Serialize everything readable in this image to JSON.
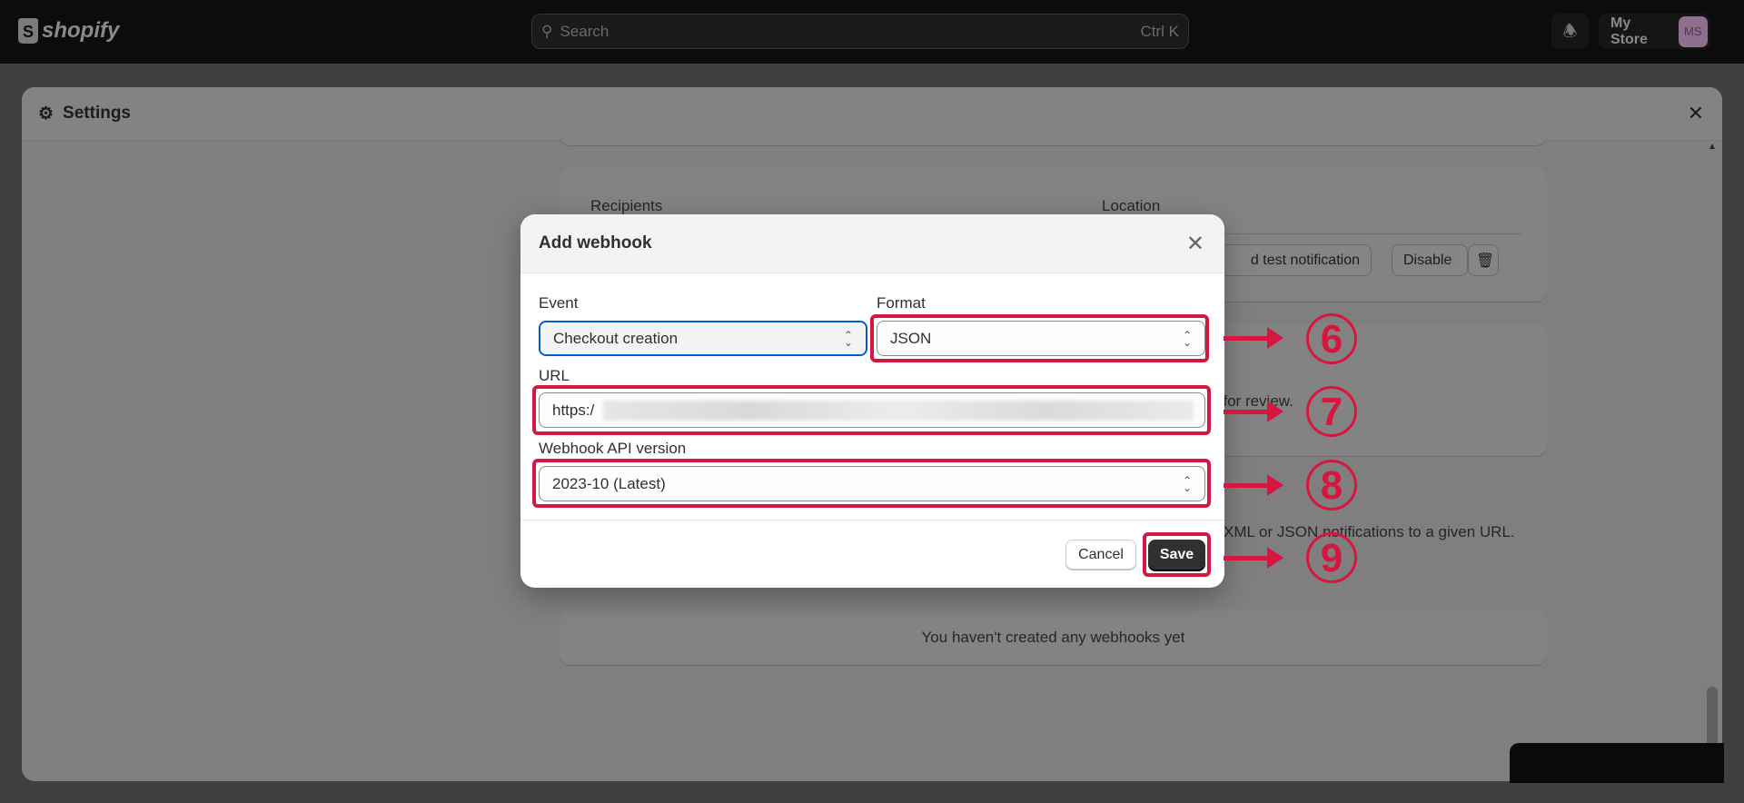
{
  "topbar": {
    "logo": "shopify",
    "search_placeholder": "Search",
    "search_shortcut": "Ctrl K",
    "store_name": "My Store",
    "avatar_initials": "MS"
  },
  "settings": {
    "title": "Settings"
  },
  "background": {
    "recipients_header": "Recipients",
    "location_header": "Location",
    "send_test_label": "d test notification",
    "disable_label": "Disable",
    "review_text": "r for review.",
    "webhooks_desc": "XML or JSON notifications to a given URL.",
    "empty_state": "You haven't created any webhooks yet"
  },
  "modal": {
    "title": "Add webhook",
    "event_label": "Event",
    "event_value": "Checkout creation",
    "format_label": "Format",
    "format_value": "JSON",
    "url_label": "URL",
    "url_value": "https:/",
    "api_label": "Webhook API version",
    "api_value": "2023-10 (Latest)",
    "cancel_label": "Cancel",
    "save_label": "Save"
  },
  "annotations": {
    "color": "#d6163f",
    "steps": [
      "6",
      "7",
      "8",
      "9"
    ]
  }
}
